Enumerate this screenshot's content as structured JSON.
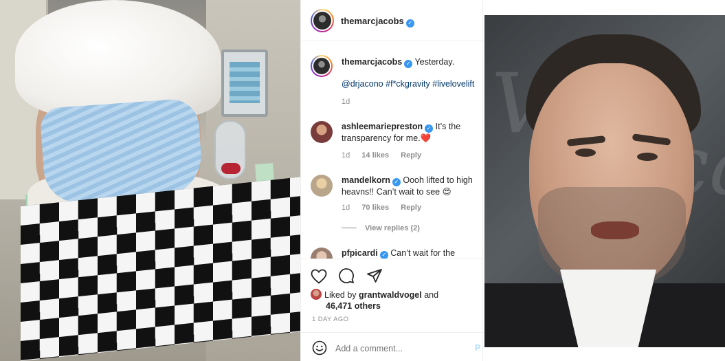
{
  "post": {
    "username": "themarcjacobs",
    "caption_text": "Yesterday.",
    "caption_tags": "@drjacono #f*ckgravity #livelovelift",
    "caption_time": "1d"
  },
  "comments": [
    {
      "username": "ashleemariepreston",
      "text": "It’s the transparency for me.",
      "emoji": "❤️",
      "time": "1d",
      "likes": "14 likes",
      "reply": "Reply"
    },
    {
      "username": "mandelkorn",
      "text": "Oooh lifted to high heavns!! Can’t wait to see",
      "emoji": "😍",
      "time": "1d",
      "likes": "70 likes",
      "reply": "Reply"
    },
    {
      "username": "pfpicardi",
      "text": "Can’t wait for the"
    }
  ],
  "view_replies": "View replies (2)",
  "likes": {
    "prefix": "Liked by",
    "user": "grantwaldvogel",
    "suffix": "and",
    "others": "46,471 others"
  },
  "timestamp": "1 DAY AGO",
  "comment_box": {
    "placeholder": "Add a comment...",
    "post_label": "P"
  },
  "icons": [
    "heart-icon",
    "comment-icon",
    "share-icon",
    "emoji-icon",
    "verified-icon"
  ],
  "colors": {
    "verified": "#3897f0",
    "link": "#00376b",
    "muted": "#8e8e8e",
    "heart": "#ed4956"
  }
}
